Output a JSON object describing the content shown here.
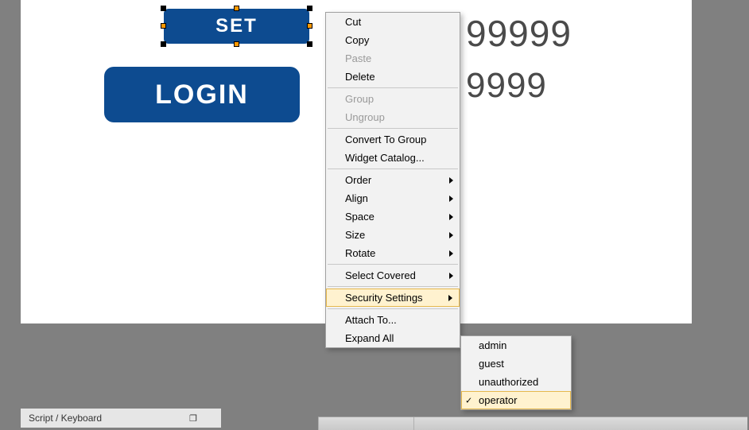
{
  "canvas": {
    "buttons": {
      "set": "SET",
      "login": "LOGIN"
    },
    "numbers": {
      "line1": "99999",
      "line2": "9999"
    }
  },
  "ctx_menu": {
    "items": [
      {
        "label": "Cut",
        "enabled": true,
        "submenu": false
      },
      {
        "label": "Copy",
        "enabled": true,
        "submenu": false
      },
      {
        "label": "Paste",
        "enabled": false,
        "submenu": false
      },
      {
        "label": "Delete",
        "enabled": true,
        "submenu": false
      },
      {
        "sep": true
      },
      {
        "label": "Group",
        "enabled": false,
        "submenu": false
      },
      {
        "label": "Ungroup",
        "enabled": false,
        "submenu": false
      },
      {
        "sep": true
      },
      {
        "label": "Convert To Group",
        "enabled": true,
        "submenu": false
      },
      {
        "label": "Widget Catalog...",
        "enabled": true,
        "submenu": false
      },
      {
        "sep": true
      },
      {
        "label": "Order",
        "enabled": true,
        "submenu": true
      },
      {
        "label": "Align",
        "enabled": true,
        "submenu": true
      },
      {
        "label": "Space",
        "enabled": true,
        "submenu": true
      },
      {
        "label": "Size",
        "enabled": true,
        "submenu": true
      },
      {
        "label": "Rotate",
        "enabled": true,
        "submenu": true
      },
      {
        "sep": true
      },
      {
        "label": "Select Covered",
        "enabled": true,
        "submenu": true
      },
      {
        "sep": true
      },
      {
        "label": "Security Settings",
        "enabled": true,
        "submenu": true,
        "highlight": true
      },
      {
        "sep": true
      },
      {
        "label": "Attach To...",
        "enabled": true,
        "submenu": false
      },
      {
        "label": "Expand All",
        "enabled": true,
        "submenu": false
      }
    ]
  },
  "submenu_security": {
    "items": [
      {
        "label": "admin",
        "highlight": false
      },
      {
        "label": "guest",
        "highlight": false
      },
      {
        "label": "unauthorized",
        "highlight": false
      },
      {
        "label": "operator",
        "highlight": true,
        "checked": true
      }
    ]
  },
  "bottom_tab": {
    "label": "Script / Keyboard"
  }
}
